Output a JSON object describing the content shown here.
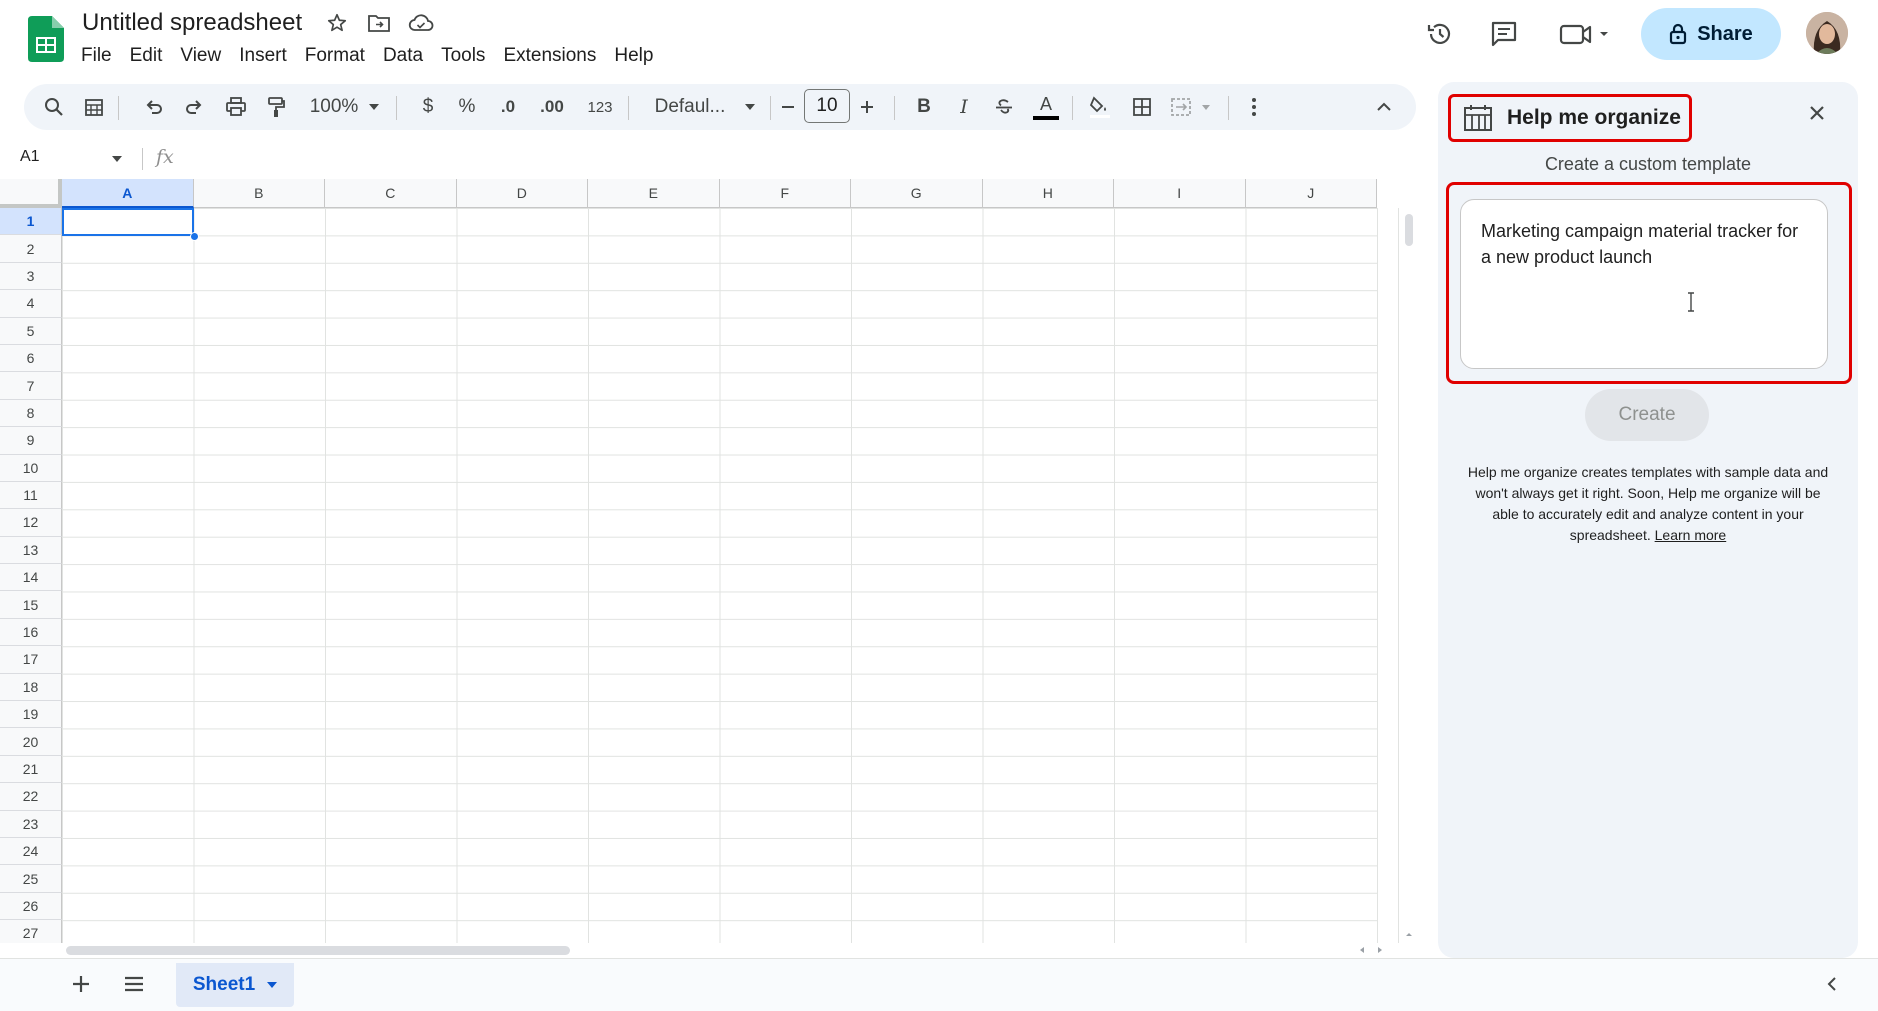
{
  "app": {
    "title": "Untitled spreadsheet",
    "menu": [
      "File",
      "Edit",
      "View",
      "Insert",
      "Format",
      "Data",
      "Tools",
      "Extensions",
      "Help"
    ],
    "share_label": "Share",
    "colors": {
      "accent": "#0b57d0",
      "share_bg": "#c2e7ff",
      "highlight": "#e00000",
      "sheets_green": "#0f9d58"
    }
  },
  "toolbar": {
    "zoom": "100%",
    "currency": "$",
    "percent": "%",
    "dec_decrease": ".0",
    "dec_increase": ".00",
    "number_format": "123",
    "font": "Defaul...",
    "font_size": "10",
    "bold": "B",
    "italic": "I",
    "text_color_letter": "A"
  },
  "formula_bar": {
    "name_box": "A1",
    "fx": "fx",
    "value": ""
  },
  "grid": {
    "columns": [
      "A",
      "B",
      "C",
      "D",
      "E",
      "F",
      "G",
      "H",
      "I",
      "J"
    ],
    "rows": [
      "1",
      "2",
      "3",
      "4",
      "5",
      "6",
      "7",
      "8",
      "9",
      "10",
      "11",
      "12",
      "13",
      "14",
      "15",
      "16",
      "17",
      "18",
      "19",
      "20",
      "21",
      "22",
      "23",
      "24",
      "25",
      "26",
      "27"
    ],
    "selected_cell": "A1"
  },
  "sheets": {
    "tabs": [
      "Sheet1"
    ],
    "active": "Sheet1"
  },
  "panel": {
    "title": "Help me organize",
    "subtitle": "Create a custom template",
    "prompt_text": "Marketing campaign material tracker for a new product launch",
    "create_label": "Create",
    "disclaimer": "Help me organize creates templates with sample data and won't always get it right. Soon, Help me organize will be able to accurately edit and analyze content in your spreadsheet.",
    "learn_more": "Learn more"
  }
}
